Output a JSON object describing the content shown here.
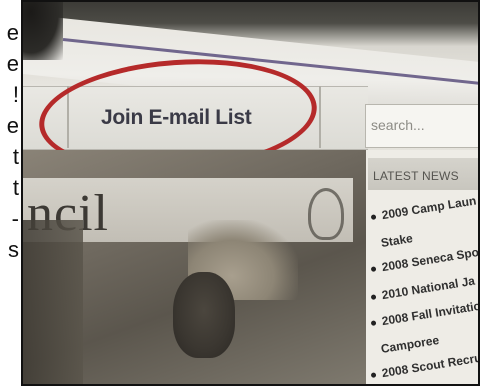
{
  "left_text": [
    "e",
    "e",
    "!",
    "e",
    "t",
    "t",
    "-",
    "s"
  ],
  "nav": {
    "join_label": "Join E-mail List"
  },
  "search": {
    "placeholder": "search..."
  },
  "news": {
    "header": "LATEST NEWS",
    "items": [
      "2009 Camp Laun",
      "Stake",
      "2008 Seneca Spo",
      "2010 National Ja",
      "2008 Fall Invitatio",
      "Camporee",
      "2008 Scout Recru"
    ]
  },
  "hero": {
    "word": "ncil"
  },
  "colors": {
    "circle": "#b52a2a",
    "nav_text": "#3a3a46",
    "accent_line": "#5a4f7c"
  }
}
